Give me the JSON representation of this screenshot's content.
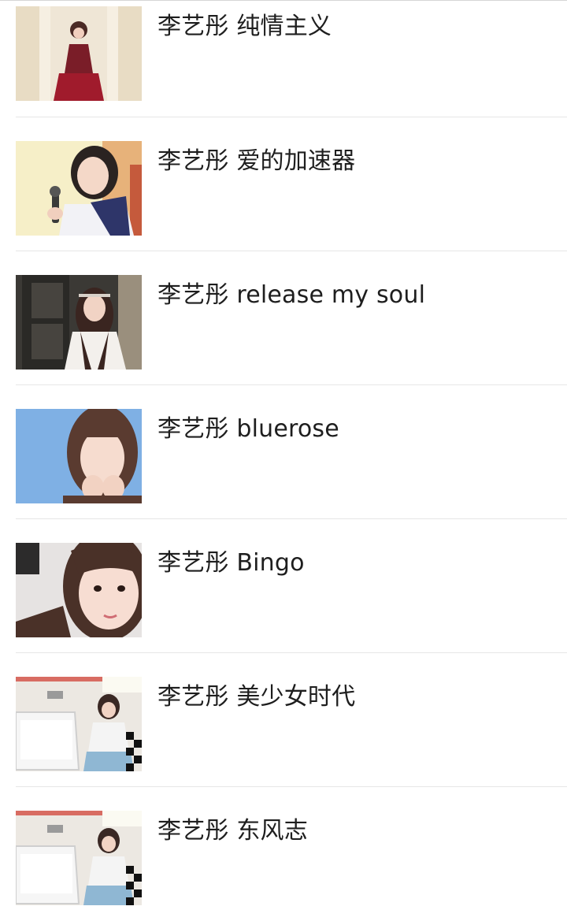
{
  "list": {
    "items": [
      {
        "title": "李艺彤 纯情主义",
        "thumb_icon": "photo-thumbnail-stage"
      },
      {
        "title": "李艺彤 爱的加速器",
        "thumb_icon": "photo-thumbnail-microphone"
      },
      {
        "title": "李艺彤 release my soul",
        "thumb_icon": "photo-thumbnail-door"
      },
      {
        "title": "李艺彤 bluerose",
        "thumb_icon": "photo-thumbnail-blue-portrait"
      },
      {
        "title": "李艺彤 Bingo",
        "thumb_icon": "photo-thumbnail-closeup"
      },
      {
        "title": "李艺彤 美少女时代",
        "thumb_icon": "photo-thumbnail-bathroom"
      },
      {
        "title": "李艺彤 东风志",
        "thumb_icon": "photo-thumbnail-bathroom"
      }
    ]
  },
  "colors": {
    "background": "#ffffff",
    "separator": "#e6e6e6",
    "text": "#1e1e1e"
  }
}
